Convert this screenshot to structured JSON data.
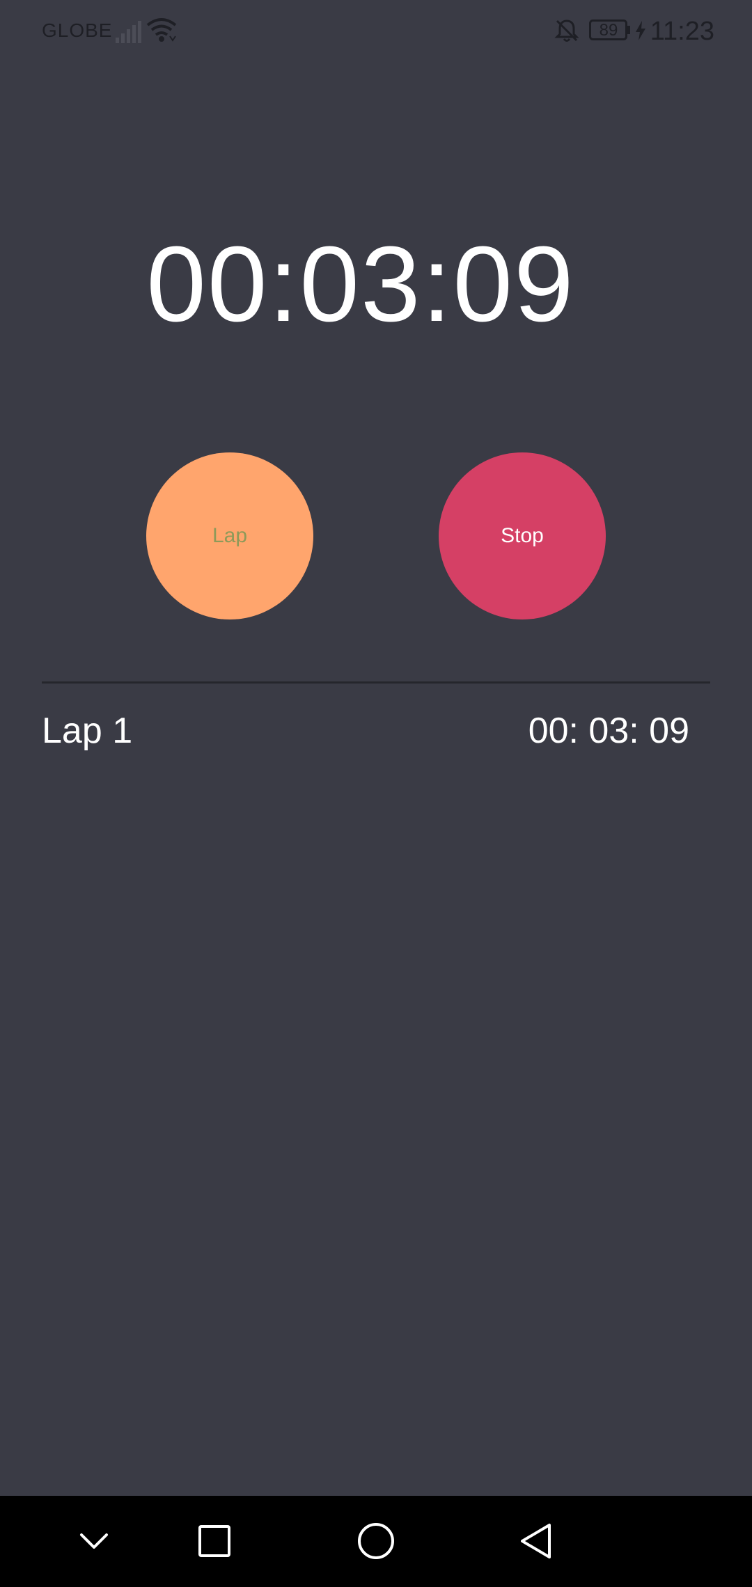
{
  "status_bar": {
    "carrier": "GLOBE",
    "battery": "89",
    "time": "11:23",
    "icons": [
      "signal-icon",
      "wifi-icon",
      "bell-off-icon",
      "battery-icon",
      "charge-icon"
    ]
  },
  "stopwatch": {
    "time": "00:03:09",
    "lap_button_label": "Lap",
    "stop_button_label": "Stop"
  },
  "laps": [
    {
      "label": "Lap 1",
      "time": "00: 03: 09"
    }
  ],
  "nav_bar": {
    "icons": [
      "chevron-down-icon",
      "recents-square-icon",
      "home-circle-icon",
      "back-triangle-icon"
    ]
  },
  "colors": {
    "background": "#3a3b45",
    "lap_button": "#ffa56d",
    "lap_text": "#8e9a59",
    "stop_button": "#d54065",
    "nav_bar": "#000000"
  }
}
